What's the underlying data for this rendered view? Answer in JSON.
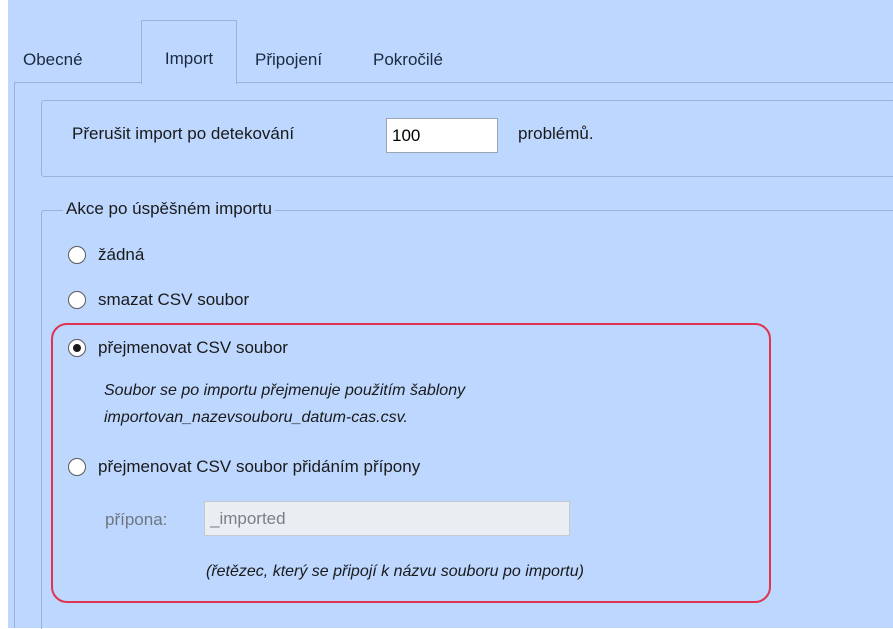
{
  "tabs": [
    {
      "label": "Obecné"
    },
    {
      "label": "Import",
      "active": true
    },
    {
      "label": "Připojení"
    },
    {
      "label": "Pokročilé"
    }
  ],
  "abort": {
    "label_before": "Přerušit import po detekování",
    "value": "100",
    "label_after": "problémů."
  },
  "after_import": {
    "group_title": "Akce po úspěšném importu",
    "options": [
      {
        "label": "žádná",
        "selected": false
      },
      {
        "label": "smazat CSV soubor",
        "selected": false
      },
      {
        "label": "přejmenovat CSV soubor",
        "selected": true
      },
      {
        "label": "přejmenovat CSV soubor přidáním přípony",
        "selected": false
      }
    ],
    "rename_note_line1": "Soubor se po importu přejmenuje použitím šablony",
    "rename_note_line2": "importovan_nazevsouboru_datum-cas.csv.",
    "suffix_label": "přípona:",
    "suffix_value": "_imported",
    "suffix_note": "(řetězec, který se připojí k názvu souboru po importu)"
  },
  "colors": {
    "panel_bg": "#bdd7ff",
    "highlight_border": "#e0334f"
  }
}
